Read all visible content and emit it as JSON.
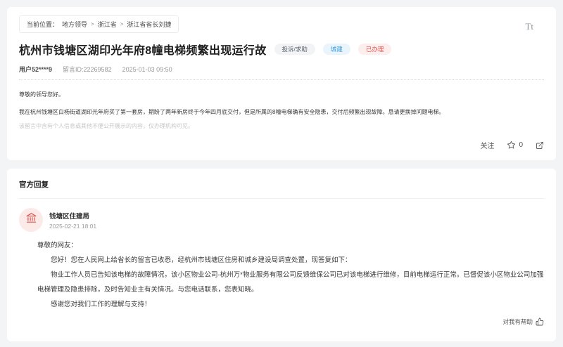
{
  "message_card": {
    "breadcrumb": {
      "prefix": "当前位置：",
      "items": [
        "地方领导",
        "浙江省",
        "浙江省省长刘捷"
      ],
      "separator": ">"
    },
    "font_size_control": "Tt",
    "title": "杭州市钱塘区湖印光年府8幢电梯频繁出现运行故",
    "tags": [
      {
        "label": "投诉/求助",
        "type": "gray"
      },
      {
        "label": "城建",
        "type": "blue"
      },
      {
        "label": "已办理",
        "type": "red"
      }
    ],
    "meta": {
      "user": "用户52****9",
      "message_id": "留言ID:22269582",
      "date": "2025-01-03 09:50"
    },
    "body": [
      "尊敬的领导您好。",
      "我在杭州钱塘区白杨街道湖印光年府买了第一套房，期盼了两年新房终于今年四月底交付，但是所属的8幢电梯确有安全隐患，交付后频繁出现故障。恳请更换掉问题电梯。"
    ],
    "privacy_note": "该留言中含有个人信息或其他不便公开展示的内容，仅办理机构可见。",
    "actions": {
      "follow": "关注",
      "star_count": "0",
      "star_icon": "star-outline",
      "share_icon": "share-forward"
    }
  },
  "reply_card": {
    "section_title": "官方回复",
    "agency": "钱塘区住建局",
    "agency_icon": "government-building",
    "reply_date": "2025-02-21 18:01",
    "paragraphs": [
      "尊敬的网友：",
      "您好！您在人民网上给省长的留言已收悉，经杭州市钱塘区住房和城乡建设局调查处置，现答复如下：",
      "物业工作人员已告知该电梯的故障情况，该小区物业公司-杭州万*物业服务有限公司反馈维保公司已对该电梯进行维修，目前电梯运行正常。已督促该小区物业公司加强电梯管理及隐患排除，及时告知业主有关情况。与您电话联系，您表知晓。",
      "感谢您对我们工作的理解与支持！"
    ],
    "helpful_label": "对我有帮助",
    "helpful_icon": "thumbs-up"
  },
  "colors": {
    "page_background": "#f3f4f6",
    "tag_gray_text": "#5f6672",
    "tag_gray_bg": "#f2f3f5",
    "tag_blue_text": "#3d9bdc",
    "tag_blue_bg": "#e9f4fc",
    "tag_red_text": "#e25550",
    "tag_red_bg": "#fdeeee",
    "agency_icon_red": "#d9534f",
    "agency_avatar_bg": "#fbeae8"
  }
}
